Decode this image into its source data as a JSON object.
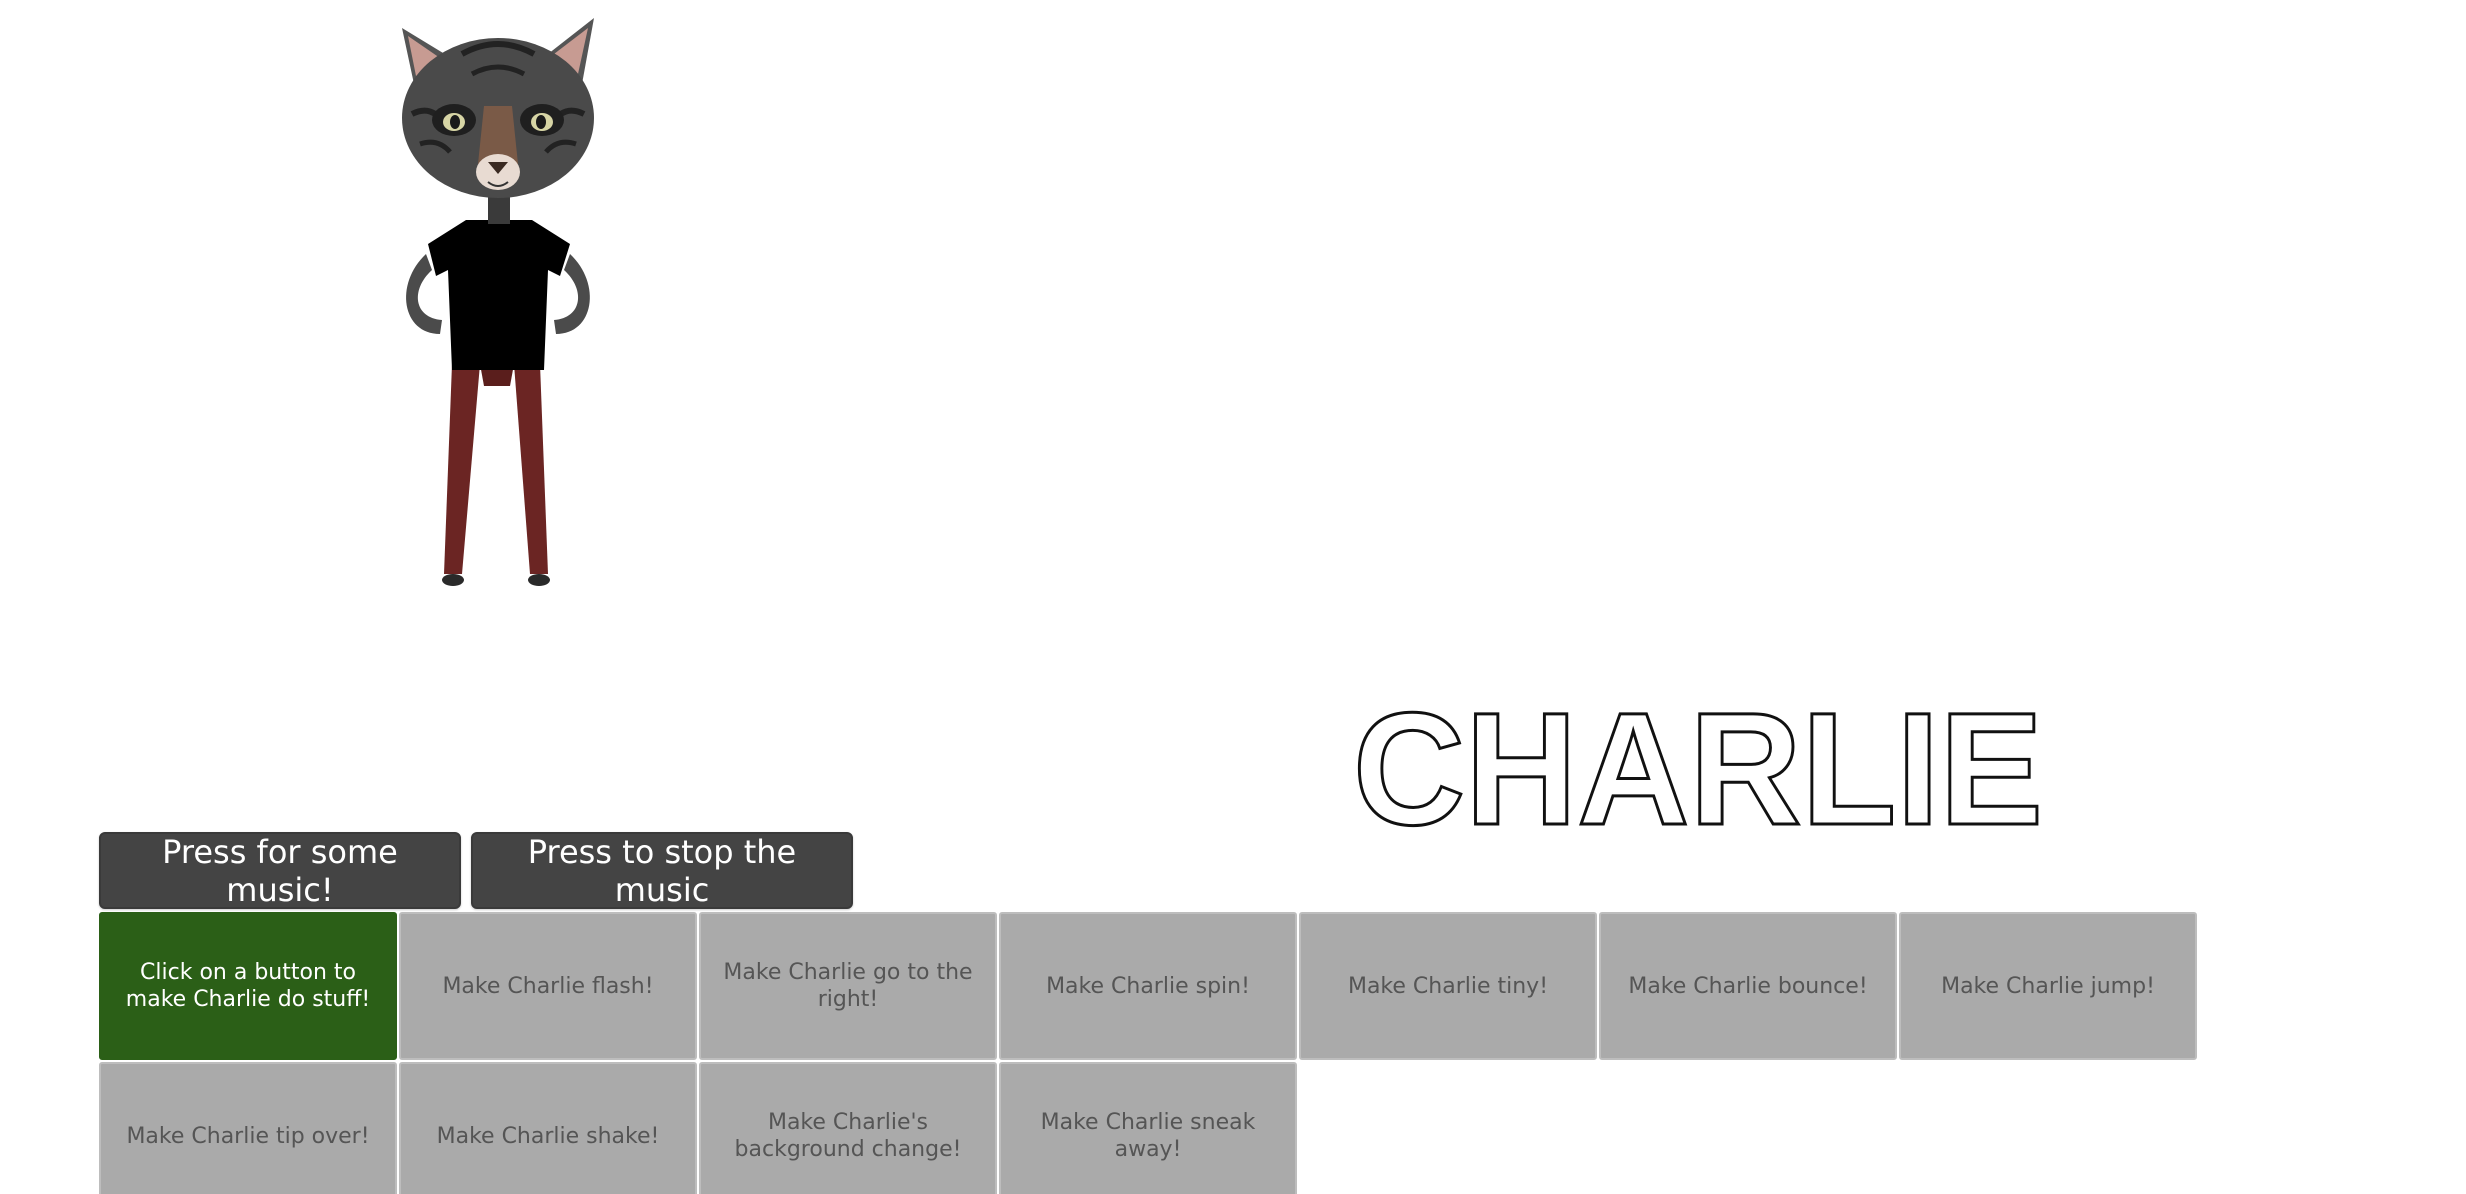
{
  "title": {
    "text": "CHARLIE"
  },
  "music": {
    "play_label": "Press for some music!",
    "stop_label": "Press to stop the music"
  },
  "tiles": {
    "info": "Click on a button to make Charlie do stuff!",
    "flash": "Make Charlie flash!",
    "right": "Make Charlie go to the right!",
    "spin": "Make Charlie spin!",
    "tiny": "Make Charlie tiny!",
    "bounce": "Make Charlie bounce!",
    "jump": "Make Charlie jump!",
    "tip": "Make Charlie tip over!",
    "shake": "Make Charlie shake!",
    "background": "Make Charlie's background change!",
    "sneak": "Make Charlie sneak away!"
  },
  "colors": {
    "info_tile": "#2b5f17",
    "action_tile": "#aaaaaa",
    "music_button": "#444444"
  },
  "icons": {
    "character": "charlie-cat-figure"
  }
}
